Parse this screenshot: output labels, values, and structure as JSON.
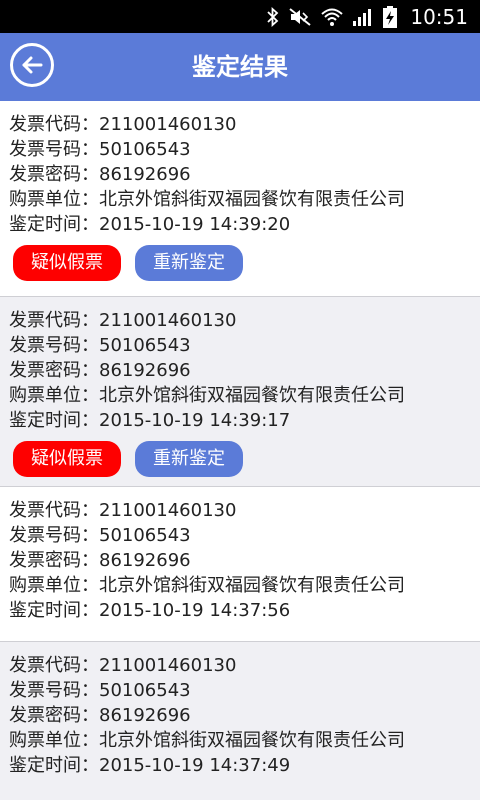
{
  "status_bar": {
    "time": "10:51",
    "icons": [
      "bluetooth-icon",
      "mute-icon",
      "wifi-icon",
      "signal-icon",
      "battery-charging-icon"
    ]
  },
  "header": {
    "title": "鉴定结果",
    "back_icon": "arrow-left-icon"
  },
  "labels": {
    "invoice_code": "发票代码：",
    "invoice_number": "发票号码：",
    "invoice_password": "发票密码：",
    "buyer": "购票单位：",
    "check_time": "鉴定时间："
  },
  "results": [
    {
      "invoice_code": "211001460130",
      "invoice_number": "50106543",
      "invoice_password": "86192696",
      "buyer": "北京外馆斜街双福园餐饮有限责任公司",
      "check_time": "2015-10-19 14:39:20",
      "fake_label": "疑似假票",
      "recheck_label": "重新鉴定"
    },
    {
      "invoice_code": "211001460130",
      "invoice_number": "50106543",
      "invoice_password": "86192696",
      "buyer": "北京外馆斜街双福园餐饮有限责任公司",
      "check_time": "2015-10-19 14:39:17",
      "fake_label": "疑似假票",
      "recheck_label": "重新鉴定"
    },
    {
      "invoice_code": "211001460130",
      "invoice_number": "50106543",
      "invoice_password": "86192696",
      "buyer": "北京外馆斜街双福园餐饮有限责任公司",
      "check_time": "2015-10-19 14:37:56"
    },
    {
      "invoice_code": "211001460130",
      "invoice_number": "50106543",
      "invoice_password": "86192696",
      "buyer": "北京外馆斜街双福园餐饮有限责任公司",
      "check_time": "2015-10-19 14:37:49"
    }
  ]
}
